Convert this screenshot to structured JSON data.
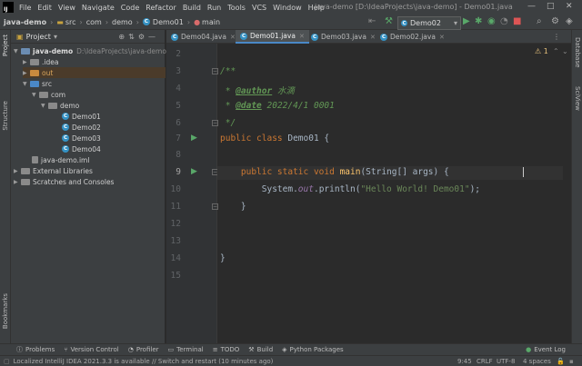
{
  "menubar": {
    "logo": "IJ",
    "items": [
      "File",
      "Edit",
      "View",
      "Navigate",
      "Code",
      "Refactor",
      "Build",
      "Run",
      "Tools",
      "VCS",
      "Window",
      "Help"
    ],
    "title": "java-demo [D:\\IdeaProjects\\java-demo] - Demo01.java"
  },
  "breadcrumb": [
    "java-demo",
    "src",
    "com",
    "demo",
    "Demo01",
    "main"
  ],
  "run_config": "Demo02",
  "left_strip": {
    "project": "Project",
    "structure": "Structure",
    "bookmarks": "Bookmarks"
  },
  "right_strip": {
    "database": "Database",
    "sciview": "SciView"
  },
  "project_panel": {
    "header": "Project",
    "tree": [
      {
        "label": "java-demo",
        "extra": "D:\\IdeaProjects\\java-demo"
      },
      {
        "label": ".idea"
      },
      {
        "label": "out"
      },
      {
        "label": "src"
      },
      {
        "label": "com"
      },
      {
        "label": "demo"
      },
      {
        "label": "Demo01"
      },
      {
        "label": "Demo02"
      },
      {
        "label": "Demo03"
      },
      {
        "label": "Demo04"
      },
      {
        "label": "java-demo.iml"
      },
      {
        "label": "External Libraries"
      },
      {
        "label": "Scratches and Consoles"
      }
    ]
  },
  "tabs": [
    "Demo04.java",
    "Demo01.java",
    "Demo03.java",
    "Demo02.java"
  ],
  "editor": {
    "line_numbers": [
      "2",
      "3",
      "4",
      "5",
      "6",
      "7",
      "8",
      "9",
      "10",
      "11",
      "12",
      "13",
      "14",
      "15"
    ],
    "lines": {
      "l3": "/**",
      "l4_star": " * ",
      "l4_tag": "@author",
      "l4_val": " 水滴",
      "l5_star": " * ",
      "l5_tag": "@date",
      "l5_val": " 2022/4/1 0001",
      "l6": " */",
      "l7_kw": "public class ",
      "l7_name": "Demo01 {",
      "l9_kw": "    public static void ",
      "l9_fn": "main",
      "l9_rest": "(String[] args) {",
      "l10_a": "        System.",
      "l10_out": "out",
      "l10_b": ".println(",
      "l10_str": "\"Hello World! Demo01\"",
      "l10_c": ");",
      "l11": "    }",
      "l13": "}"
    },
    "warnings": "⚠ 1"
  },
  "bottom_tools": [
    "Problems",
    "Version Control",
    "Profiler",
    "Terminal",
    "TODO",
    "Build",
    "Python Packages"
  ],
  "event_log": "Event Log",
  "status": {
    "message": "Localized IntelliJ IDEA 2021.3.3 is available // Switch and restart (10 minutes ago)",
    "position": "9:45",
    "line_sep": "CRLF",
    "encoding": "UTF-8",
    "indent": "4 spaces"
  }
}
